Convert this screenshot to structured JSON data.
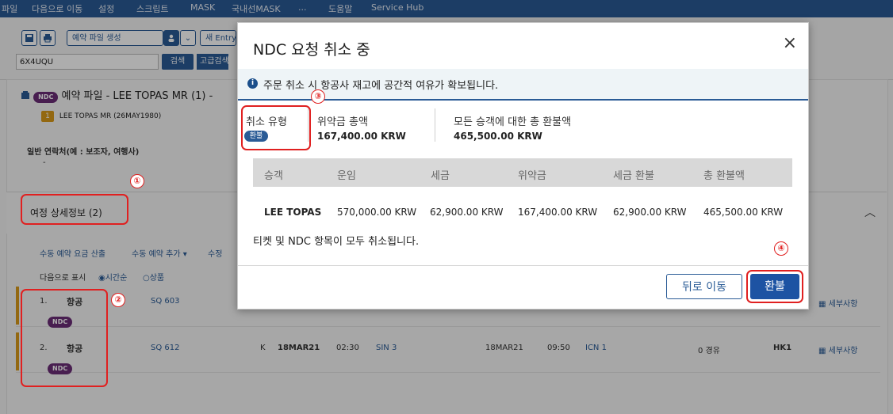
{
  "menu": {
    "items": [
      "파일",
      "다음으로 이동",
      "설정",
      "스크립트",
      "MASK",
      "국내선MASK",
      "...",
      "도움말",
      "Service Hub"
    ]
  },
  "toolbar": {
    "create_pnr_label": "예약 파일 생성",
    "new_entry_label": "새 Entry 파",
    "pnr_value": "6X4UQU",
    "search_label": "검색",
    "advanced_search_label": "고급검색"
  },
  "pnr": {
    "ndc_badge": "NDC",
    "title": "예약 파일 - LEE TOPAS MR (1) -",
    "passenger_num": "1",
    "passenger_name": "LEE TOPAS MR (26MAY1980)",
    "contact_label": "일반 연락처(예 : 보조자, 여행사)",
    "contact_value": "-"
  },
  "itinerary": {
    "title": "여정 상세정보 (2)",
    "action_manual_fare": "수동 예약 요금 산출",
    "action_add_manual": "수동 예약 추가 ▾",
    "action_edit": "수정",
    "display_label": "다음으로 표시",
    "option_time": "시간순",
    "option_product": "상품",
    "segments": [
      {
        "no": "1.",
        "type": "항공",
        "flight": "SQ 603",
        "ndc": "NDC",
        "detail_link": "세부사항"
      },
      {
        "no": "2.",
        "type": "항공",
        "flight": "SQ 612",
        "ndc": "NDC",
        "class": "K",
        "date": "18MAR21",
        "dep_time": "02:30",
        "dep_city": "SIN 3",
        "arr_date": "18MAR21",
        "arr_time": "09:50",
        "arr_city": "ICN 1",
        "stops": "0 경유",
        "status": "HK1",
        "detail_link": "세부사항"
      }
    ]
  },
  "annotations": [
    "①",
    "②",
    "③",
    "④"
  ],
  "modal": {
    "title": "NDC 요청 취소 중",
    "close_glyph": "×",
    "info_icon": "i",
    "info_text": "주문 취소 시 항공사 재고에 공간적 여유가 확보됩니다.",
    "cancel_type_label": "취소 유형",
    "cancel_type_value": "환불",
    "penalty_total_label": "위약금 총액",
    "penalty_total_value": "167,400.00 KRW",
    "refund_total_label": "모든 승객에 대한 총 환불액",
    "refund_total_value": "465,500.00 KRW",
    "table": {
      "headers": [
        "승객",
        "운임",
        "세금",
        "위약금",
        "세금 환불",
        "총 환불액"
      ],
      "rows": [
        [
          "LEE TOPAS",
          "570,000.00 KRW",
          "62,900.00 KRW",
          "167,400.00 KRW",
          "62,900.00 KRW",
          "465,500.00 KRW"
        ]
      ]
    },
    "note": "티켓 및 NDC 항목이 모두 취소됩니다.",
    "back_label": "뒤로 이동",
    "refund_label": "환불"
  }
}
